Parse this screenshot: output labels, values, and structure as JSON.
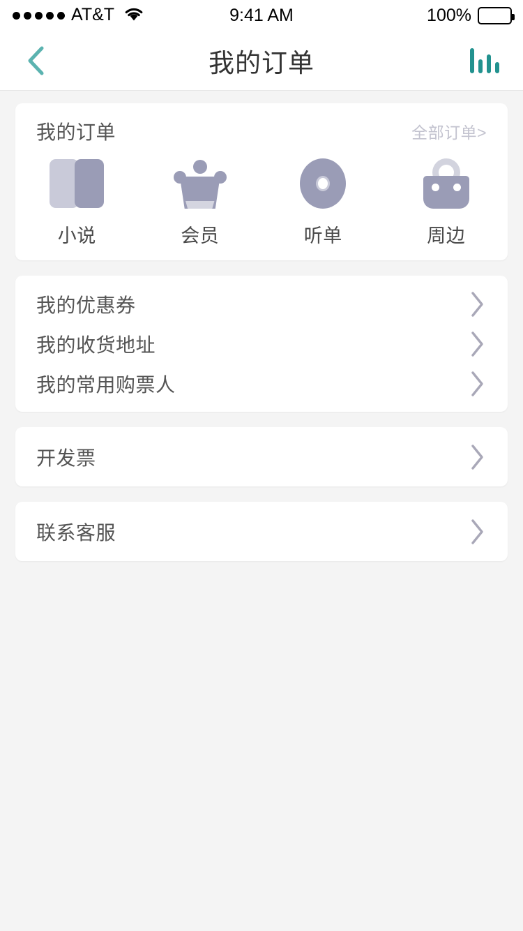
{
  "status_bar": {
    "carrier": "AT&T",
    "signal_dots": 5,
    "wifi_icon": "wifi-icon",
    "time": "9:41 AM",
    "battery_percent": "100%",
    "battery_level": 100
  },
  "nav_bar": {
    "back_icon": "chevron-left-icon",
    "title": "我的订单",
    "right_icon": "bar-chart-icon",
    "accent_color": "#5bb3b0"
  },
  "order_card": {
    "title": "我的订单",
    "more_label": "全部订单>",
    "items": [
      {
        "label": "小说",
        "icon": "book-icon"
      },
      {
        "label": "会员",
        "icon": "crown-icon"
      },
      {
        "label": "听单",
        "icon": "disc-icon"
      },
      {
        "label": "周边",
        "icon": "bag-icon"
      }
    ]
  },
  "menu_card": {
    "rows": [
      {
        "label": "我的优惠券",
        "chevron": "chevron-right-icon"
      },
      {
        "label": "我的收货地址",
        "chevron": "chevron-right-icon"
      },
      {
        "label": "我的常用购票人",
        "chevron": "chevron-right-icon"
      }
    ]
  },
  "invoice_card": {
    "label": "开发票",
    "chevron": "chevron-right-icon"
  },
  "support_card": {
    "label": "联系客服",
    "chevron": "chevron-right-icon"
  },
  "colors": {
    "page_background": "#f4f4f4",
    "card_background": "#ffffff",
    "accent_teal": "#5bb3b0",
    "icon_purple_dark": "#9a9cb6",
    "icon_purple_light": "#c9cad9",
    "text_primary": "#555555",
    "text_muted": "#c3c3cf",
    "chevron_grey": "#a9a8b8"
  }
}
